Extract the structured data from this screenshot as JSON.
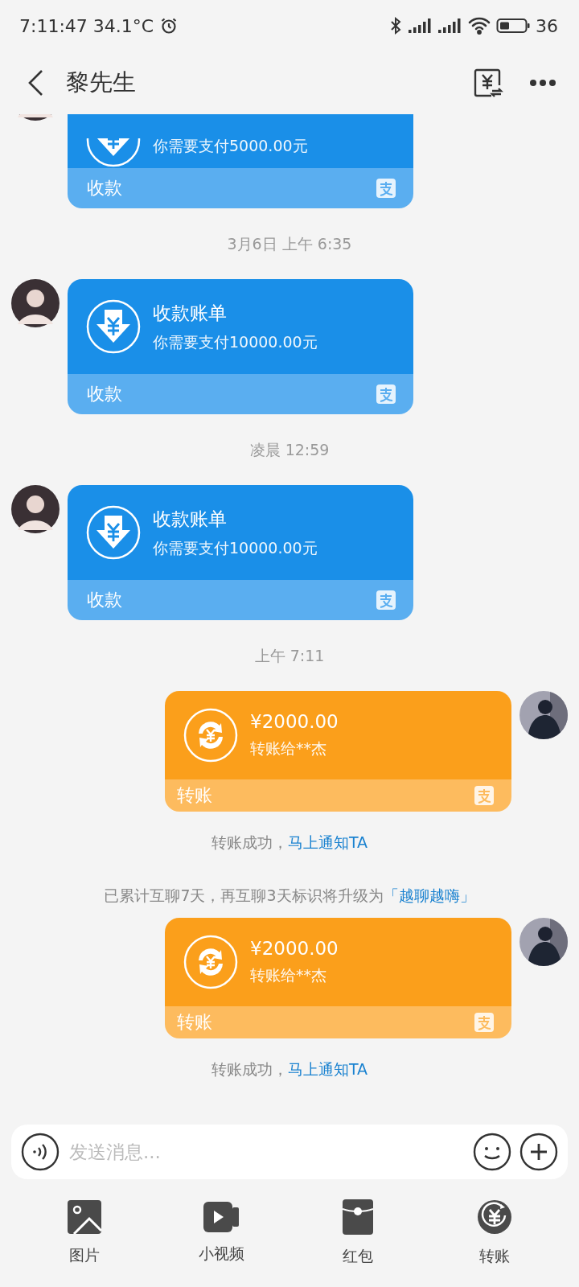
{
  "status_bar": {
    "time": "7:11:47",
    "temperature": "34.1°C",
    "battery": "36"
  },
  "header": {
    "title": "黎先生"
  },
  "messages": [
    {
      "kind": "request",
      "cut": true,
      "subtitle": "你需要支付5000.00元",
      "footer": "收款"
    },
    {
      "kind": "time",
      "text": "3月6日 上午 6:35"
    },
    {
      "kind": "request",
      "cut": false,
      "title": "收款账单",
      "subtitle": "你需要支付10000.00元",
      "footer": "收款"
    },
    {
      "kind": "time",
      "text": "凌晨 12:59"
    },
    {
      "kind": "request",
      "cut": false,
      "title": "收款账单",
      "subtitle": "你需要支付10000.00元",
      "footer": "收款"
    },
    {
      "kind": "time",
      "text": "上午 7:11"
    },
    {
      "kind": "transfer",
      "title": "¥2000.00",
      "subtitle": "转账给**杰",
      "footer": "转账"
    },
    {
      "kind": "notice",
      "text": "转账成功，",
      "link": "马上通知TA"
    },
    {
      "kind": "notice",
      "text": "已累计互聊7天，再互聊3天标识将升级为",
      "link": "「越聊越嗨」"
    },
    {
      "kind": "transfer",
      "title": "¥2000.00",
      "subtitle": "转账给**杰",
      "footer": "转账"
    },
    {
      "kind": "notice",
      "text": "转账成功，",
      "link": "马上通知TA"
    }
  ],
  "input": {
    "placeholder": "发送消息..."
  },
  "toolbar": [
    {
      "kind": "image",
      "label": "图片"
    },
    {
      "kind": "video",
      "label": "小视频"
    },
    {
      "kind": "red_packet",
      "label": "红包"
    },
    {
      "kind": "transfer",
      "label": "转账"
    }
  ]
}
